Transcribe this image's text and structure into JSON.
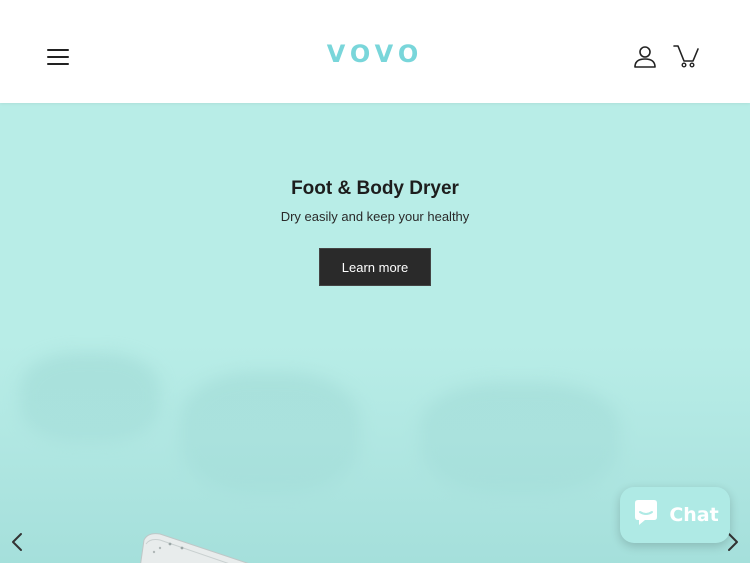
{
  "header": {
    "logo": "VOVO",
    "menu_icon": "hamburger-menu-icon",
    "account_icon": "user-icon",
    "cart_icon": "cart-icon"
  },
  "hero": {
    "title": "Foot & Body Dryer",
    "subtitle": "Dry easily and keep your healthy",
    "cta_label": "Learn more",
    "background_color": "#b8ede7"
  },
  "slider": {
    "prev_icon": "chevron-left-icon",
    "next_icon": "chevron-right-icon"
  },
  "chat": {
    "label": "Chat",
    "icon": "chat-bubble-icon"
  },
  "colors": {
    "brand": "#79d6da",
    "cta_bg": "#2a2a2a",
    "chat_bg": "#afeae5"
  }
}
